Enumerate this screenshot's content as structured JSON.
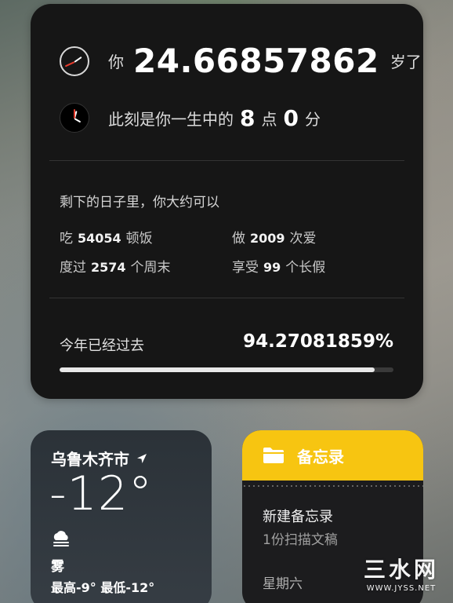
{
  "life_widget": {
    "age_prefix": "你",
    "age_value": "24.66857862",
    "age_suffix": "岁了",
    "moment_prefix": "此刻是你一生中的",
    "moment_hour": "8",
    "moment_hour_unit": "点",
    "moment_minute": "0",
    "moment_minute_unit": "分",
    "remaining_title": "剩下的日子里，你大约可以",
    "stats": [
      {
        "prefix": "吃",
        "value": "54054",
        "suffix": "顿饭"
      },
      {
        "prefix": "做",
        "value": "2009",
        "suffix": "次爱"
      },
      {
        "prefix": "度过",
        "value": "2574",
        "suffix": "个周末"
      },
      {
        "prefix": "享受",
        "value": "99",
        "suffix": "个长假"
      }
    ],
    "year_label": "今年已经过去",
    "year_percent": "94.27081859%",
    "year_progress_fraction": 0.9427
  },
  "weather_widget": {
    "city": "乌鲁木齐市",
    "temperature": "-12°",
    "condition": "雾",
    "high_low": "最高-9° 最低-12°",
    "icons": {
      "location": "location-arrow-icon",
      "condition": "fog-cloud-icon"
    }
  },
  "notes_widget": {
    "title": "备忘录",
    "note_name": "新建备忘录",
    "note_sub": "1份扫描文稿",
    "note_date": "星期六",
    "accent": "#f7c511",
    "icons": {
      "header": "folder-icon"
    }
  },
  "watermark": {
    "main": "三水网",
    "sub": "WWW.JYSS.NET"
  }
}
